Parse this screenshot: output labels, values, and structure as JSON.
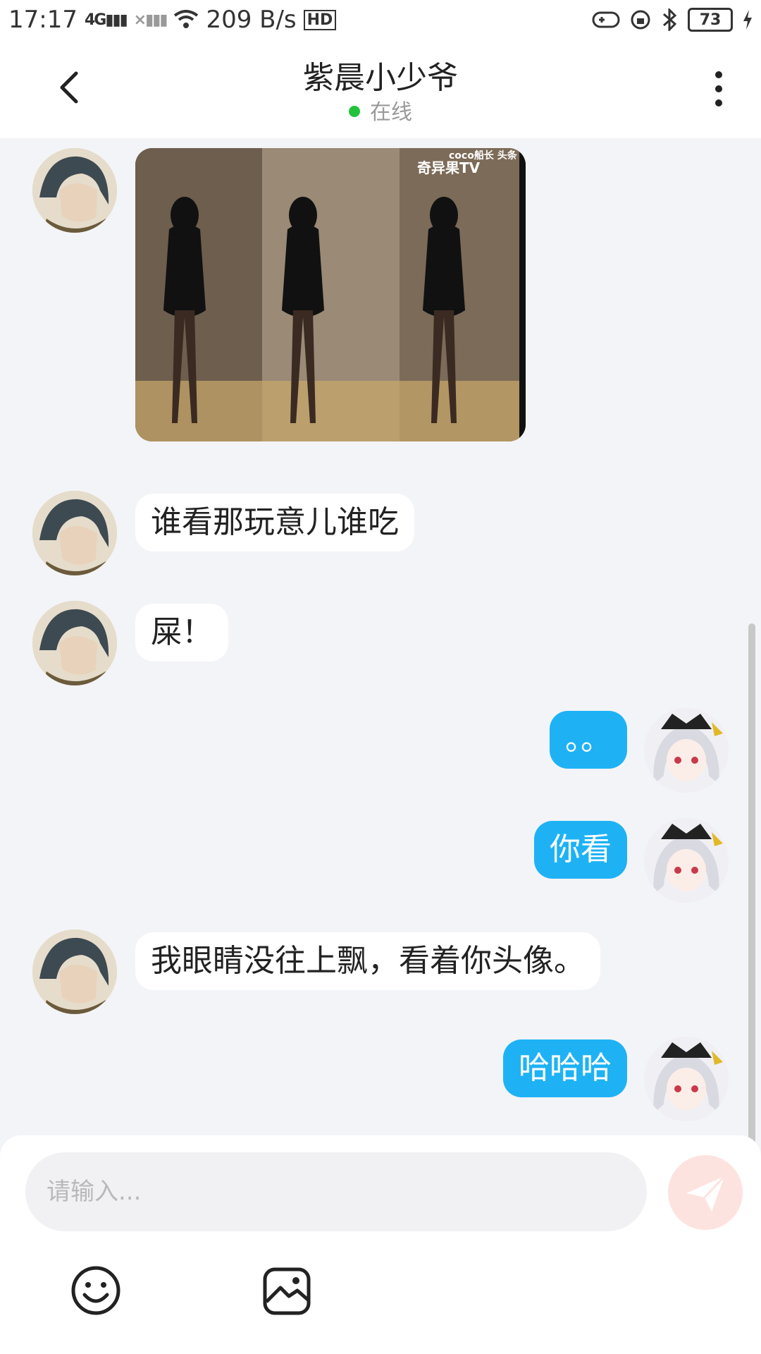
{
  "status_bar": {
    "time": "17:17",
    "network": "4G",
    "speed": "209 B/s",
    "hd": "HD",
    "battery": "73"
  },
  "header": {
    "title": "紫晨小少爷",
    "status": "在线",
    "status_color": "#22c33b"
  },
  "messages": [
    {
      "sender": "other",
      "type": "image",
      "image_watermark": "奇异果TV",
      "image_caption": "coco船长 头条"
    },
    {
      "sender": "other",
      "type": "text",
      "text": "谁看那玩意儿谁吃"
    },
    {
      "sender": "other",
      "type": "text",
      "text": "屎！"
    },
    {
      "sender": "me",
      "type": "text",
      "text": "。。"
    },
    {
      "sender": "me",
      "type": "text",
      "text": "你看"
    },
    {
      "sender": "other",
      "type": "text",
      "text": "我眼睛没往上飘，看着你头像。"
    },
    {
      "sender": "me",
      "type": "text",
      "text": "哈哈哈"
    }
  ],
  "input": {
    "placeholder": "请输入..."
  },
  "colors": {
    "accent": "#1eb2f5",
    "send_disabled": "#fde3df",
    "background": "#f3f4f7"
  },
  "icons": [
    "back-arrow-icon",
    "more-vertical-icon",
    "emoji-icon",
    "image-icon",
    "send-icon"
  ]
}
